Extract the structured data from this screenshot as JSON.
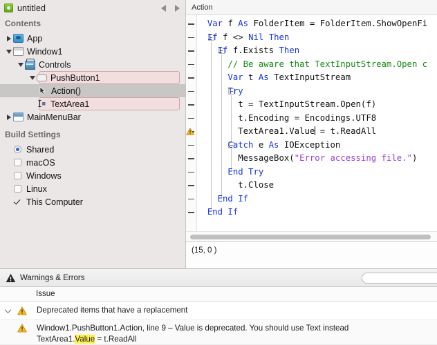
{
  "sidebar": {
    "project_title": "untitled",
    "project_icon": "xojo-project-icon",
    "nav_back_icon": "nav-back-arrow",
    "nav_forward_icon": "nav-forward-arrow",
    "contents_label": "Contents",
    "build_settings_label": "Build Settings",
    "tree": [
      {
        "label": "App",
        "icon": "app-icon",
        "state": "collapsed",
        "depth": 0,
        "style": "plain"
      },
      {
        "label": "Window1",
        "icon": "window-icon",
        "state": "expanded",
        "depth": 0,
        "style": "plain"
      },
      {
        "label": "Controls",
        "icon": "controls-icon",
        "state": "expanded",
        "depth": 1,
        "style": "plain"
      },
      {
        "label": "PushButton1",
        "icon": "pushbutton-icon",
        "state": "expanded",
        "depth": 2,
        "style": "pink"
      },
      {
        "label": "Action()",
        "icon": "event-cursor-icon",
        "state": "leaf",
        "depth": 3,
        "style": "selected"
      },
      {
        "label": "TextArea1",
        "icon": "textarea-icon",
        "state": "leaf",
        "depth": 2,
        "style": "pink"
      },
      {
        "label": "MainMenuBar",
        "icon": "menubar-icon",
        "state": "collapsed",
        "depth": 0,
        "style": "plain"
      }
    ],
    "build_targets": [
      {
        "label": "Shared",
        "control": "radio",
        "checked": true
      },
      {
        "label": "macOS",
        "control": "checkbox",
        "checked": false
      },
      {
        "label": "Windows",
        "control": "checkbox",
        "checked": false
      },
      {
        "label": "Linux",
        "control": "checkbox",
        "checked": false
      },
      {
        "label": "This Computer",
        "control": "checkmark",
        "checked": true
      }
    ]
  },
  "editor": {
    "tab_label": "Action",
    "status_text": "(15, 0 )",
    "warning_glyph": "warning-triangle-icon",
    "code_lines": [
      {
        "n": 1,
        "indent": 1,
        "fold": "none",
        "warn": false,
        "tokens": [
          {
            "t": "Var ",
            "c": "kw"
          },
          {
            "t": "f ",
            "c": ""
          },
          {
            "t": "As ",
            "c": "kw"
          },
          {
            "t": "FolderItem = FolderItem.ShowOpenFi",
            "c": ""
          }
        ]
      },
      {
        "n": 2,
        "indent": 1,
        "fold": "box",
        "warn": false,
        "tokens": [
          {
            "t": "If ",
            "c": "kw"
          },
          {
            "t": "f <> ",
            "c": ""
          },
          {
            "t": "Nil ",
            "c": "kw"
          },
          {
            "t": "Then",
            "c": "kw"
          }
        ]
      },
      {
        "n": 3,
        "indent": 2,
        "fold": "box",
        "warn": false,
        "tokens": [
          {
            "t": "If ",
            "c": "kw"
          },
          {
            "t": "f.Exists ",
            "c": ""
          },
          {
            "t": "Then",
            "c": "kw"
          }
        ]
      },
      {
        "n": 4,
        "indent": 3,
        "fold": "none",
        "warn": false,
        "tokens": [
          {
            "t": "// Be aware that TextInputStream.Open c",
            "c": "cm"
          }
        ]
      },
      {
        "n": 5,
        "indent": 3,
        "fold": "none",
        "warn": false,
        "tokens": [
          {
            "t": "Var ",
            "c": "kw"
          },
          {
            "t": "t ",
            "c": ""
          },
          {
            "t": "As ",
            "c": "kw"
          },
          {
            "t": "TextInputStream",
            "c": ""
          }
        ]
      },
      {
        "n": 6,
        "indent": 3,
        "fold": "box",
        "warn": false,
        "tokens": [
          {
            "t": "Try",
            "c": "kw"
          }
        ]
      },
      {
        "n": 7,
        "indent": 4,
        "fold": "none",
        "warn": false,
        "tokens": [
          {
            "t": "t = TextInputStream.Open(f)",
            "c": ""
          }
        ]
      },
      {
        "n": 8,
        "indent": 4,
        "fold": "none",
        "warn": false,
        "tokens": [
          {
            "t": "t.Encoding = Encodings.UTF8",
            "c": ""
          }
        ]
      },
      {
        "n": 9,
        "indent": 4,
        "fold": "none",
        "warn": true,
        "tokens": [
          {
            "t": "TextArea1.Value",
            "c": ""
          },
          {
            "t": "|caret|",
            "c": "caret"
          },
          {
            "t": " = t.ReadAll",
            "c": ""
          }
        ]
      },
      {
        "n": 10,
        "indent": 3,
        "fold": "box",
        "warn": false,
        "tokens": [
          {
            "t": "Catch ",
            "c": "kw"
          },
          {
            "t": "e ",
            "c": ""
          },
          {
            "t": "As ",
            "c": "kw"
          },
          {
            "t": "IOException",
            "c": ""
          }
        ]
      },
      {
        "n": 11,
        "indent": 4,
        "fold": "none",
        "warn": false,
        "tokens": [
          {
            "t": "MessageBox(",
            "c": ""
          },
          {
            "t": "\"Error accessing file.\"",
            "c": "st"
          },
          {
            "t": ")",
            "c": ""
          }
        ]
      },
      {
        "n": 12,
        "indent": 3,
        "fold": "end",
        "warn": false,
        "tokens": [
          {
            "t": "End Try",
            "c": "kw"
          }
        ]
      },
      {
        "n": 13,
        "indent": 4,
        "fold": "none",
        "warn": false,
        "tokens": [
          {
            "t": "t.Close",
            "c": ""
          }
        ]
      },
      {
        "n": 14,
        "indent": 2,
        "fold": "end",
        "warn": false,
        "tokens": [
          {
            "t": "End If",
            "c": "kw"
          }
        ]
      },
      {
        "n": 15,
        "indent": 1,
        "fold": "end",
        "warn": false,
        "tokens": [
          {
            "t": "End If",
            "c": "kw"
          }
        ]
      }
    ]
  },
  "warnings_panel": {
    "title": "Warnings & Errors",
    "header_icon": "warning-triangle-icon",
    "search_placeholder": "",
    "column_header": "Issue",
    "group": {
      "label": "Deprecated items that have a replacement",
      "icon": "warning-triangle-icon",
      "disclosure": "expanded"
    },
    "detail": {
      "icon": "warning-triangle-icon",
      "line1_pre": "Window1.PushButton1.Action, line 9 – Value is deprecated.  You should use Text instead",
      "line2_pre": "TextArea1.",
      "line2_highlight": "Value",
      "line2_post": " = t.ReadAll"
    }
  },
  "colors": {
    "sidebar_bg": "#ebe7e7",
    "pink_row": "#f2dede",
    "selected_row": "#c9c6c6",
    "keyword": "#1533e8",
    "comment": "#148a14",
    "string": "#9b3fd4",
    "highlight": "#ffef47",
    "warning": "#f5b820"
  }
}
